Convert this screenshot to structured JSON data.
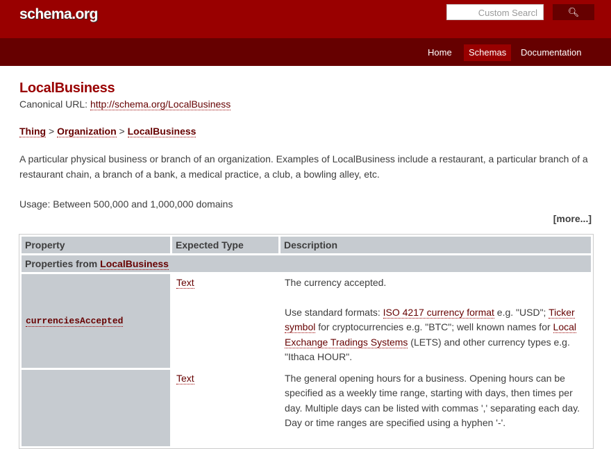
{
  "header": {
    "logo": "schema.org",
    "search_placeholder": "Custom Searcl",
    "search_icon": "search-icon"
  },
  "nav": [
    "Home",
    "Schemas",
    "Documentation"
  ],
  "page": {
    "title": "LocalBusiness",
    "canonical_label": "Canonical URL: ",
    "canonical_url": "http://schema.org/LocalBusiness",
    "breadcrumb": [
      "Thing",
      "Organization",
      "LocalBusiness"
    ],
    "sep": " > ",
    "description": "A particular physical business or branch of an organization. Examples of LocalBusiness include a restaurant, a particular branch of a restaurant chain, a branch of a bank, a medical practice, a club, a bowling alley, etc.",
    "usage": "Usage: Between 500,000 and 1,000,000 domains",
    "more": "[more...]"
  },
  "table": {
    "headers": [
      "Property",
      "Expected Type",
      "Description"
    ],
    "group_prefix": "Properties from ",
    "group_link": "LocalBusiness",
    "rows": [
      {
        "property": "currenciesAccepted",
        "type": "Text",
        "d1": "The currency accepted.",
        "d2a": "Use standard formats: ",
        "l1": "ISO 4217 currency format",
        "d2b": " e.g. \"USD\"; ",
        "l2": "Ticker symbol",
        "d2c": " for cryptocurrencies e.g. \"BTC\"; well known names for ",
        "l3": "Local Exchange Tradings Systems",
        "d2d": " (LETS) and other currency types e.g. \"Ithaca HOUR\"."
      },
      {
        "property": "",
        "type": "Text",
        "d1": "The general opening hours for a business. Opening hours can be specified as a weekly time range, starting with days, then times per day. Multiple days can be listed with commas ',' separating each day. Day or time ranges are specified using a hyphen '-'."
      }
    ]
  }
}
